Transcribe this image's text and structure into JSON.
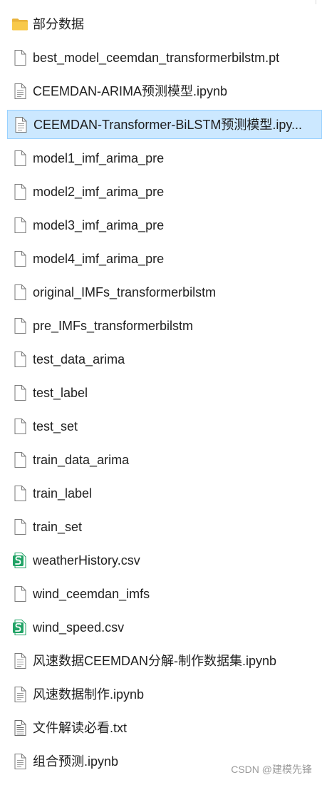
{
  "files": [
    {
      "name": "部分数据",
      "icon": "folder-icon",
      "selected": false
    },
    {
      "name": "best_model_ceemdan_transformerbilstm.pt",
      "icon": "file-icon",
      "selected": false
    },
    {
      "name": "CEEMDAN-ARIMA预测模型.ipynb",
      "icon": "notebook-file-icon",
      "selected": false
    },
    {
      "name": "CEEMDAN-Transformer-BiLSTM预测模型.ipy...",
      "icon": "notebook-file-icon",
      "selected": true
    },
    {
      "name": "model1_imf_arima_pre",
      "icon": "file-icon",
      "selected": false
    },
    {
      "name": "model2_imf_arima_pre",
      "icon": "file-icon",
      "selected": false
    },
    {
      "name": "model3_imf_arima_pre",
      "icon": "file-icon",
      "selected": false
    },
    {
      "name": "model4_imf_arima_pre",
      "icon": "file-icon",
      "selected": false
    },
    {
      "name": "original_IMFs_transformerbilstm",
      "icon": "file-icon",
      "selected": false
    },
    {
      "name": "pre_IMFs_transformerbilstm",
      "icon": "file-icon",
      "selected": false
    },
    {
      "name": "test_data_arima",
      "icon": "file-icon",
      "selected": false
    },
    {
      "name": "test_label",
      "icon": "file-icon",
      "selected": false
    },
    {
      "name": "test_set",
      "icon": "file-icon",
      "selected": false
    },
    {
      "name": "train_data_arima",
      "icon": "file-icon",
      "selected": false
    },
    {
      "name": "train_label",
      "icon": "file-icon",
      "selected": false
    },
    {
      "name": "train_set",
      "icon": "file-icon",
      "selected": false
    },
    {
      "name": "weatherHistory.csv",
      "icon": "csv-file-icon",
      "selected": false
    },
    {
      "name": "wind_ceemdan_imfs",
      "icon": "file-icon",
      "selected": false
    },
    {
      "name": "wind_speed.csv",
      "icon": "csv-file-icon",
      "selected": false
    },
    {
      "name": "风速数据CEEMDAN分解-制作数据集.ipynb",
      "icon": "notebook-file-icon",
      "selected": false
    },
    {
      "name": "风速数据制作.ipynb",
      "icon": "notebook-file-icon",
      "selected": false
    },
    {
      "name": "文件解读必看.txt",
      "icon": "text-file-icon",
      "selected": false
    },
    {
      "name": "组合预测.ipynb",
      "icon": "notebook-file-icon",
      "selected": false
    }
  ],
  "watermark": "CSDN @建模先锋",
  "colors": {
    "selected_bg": "#cce8ff",
    "selected_border": "#99d1ff",
    "folder": "#f8c94a",
    "csv": "#21a366"
  }
}
